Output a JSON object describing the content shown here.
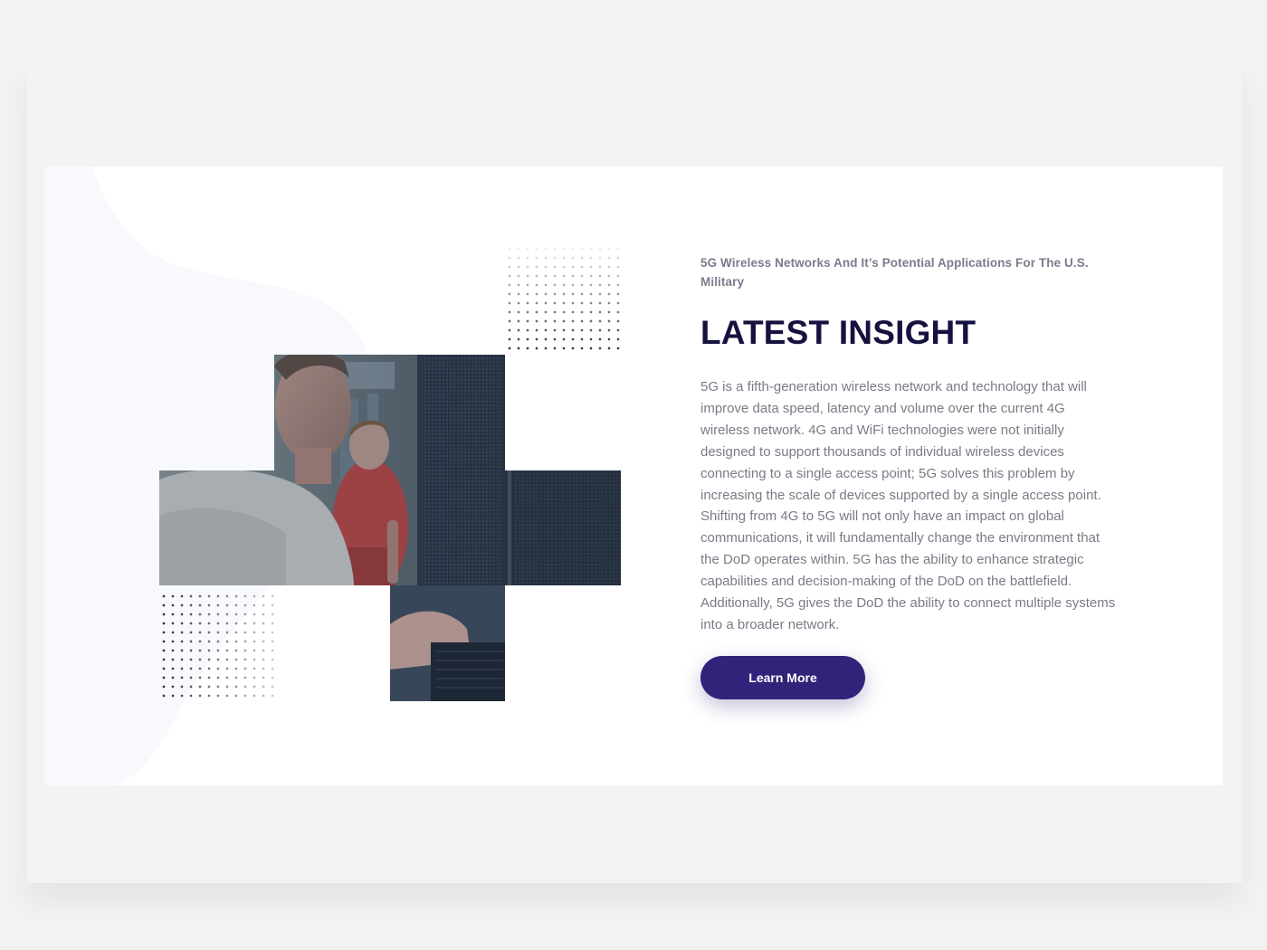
{
  "insight": {
    "eyebrow": "5G Wireless Networks And It’s Potential Applications For The U.S. Military",
    "title": "LATEST INSIGHT",
    "body": "5G is a fifth-generation wireless network and technology that will improve data speed, latency and volume over the current 4G wireless network. 4G and WiFi technologies were not initially designed to support thousands of individual wireless devices connecting to a single access point; 5G solves this problem by increasing the scale of devices supported by a single access point. Shifting from 4G to 5G will not only have an impact on global communications, it will fundamentally change the environment that the DoD operates within. 5G has the ability to enhance strategic capabilities and decision-making of the DoD on the battlefield. Additionally, 5G gives the DoD the ability to connect multiple systems into a broader network.",
    "button_label": "Learn More"
  },
  "colors": {
    "accent": "#332279",
    "title": "#15123f",
    "text": "#7a7b87",
    "eyebrow": "#7b7c8c"
  }
}
